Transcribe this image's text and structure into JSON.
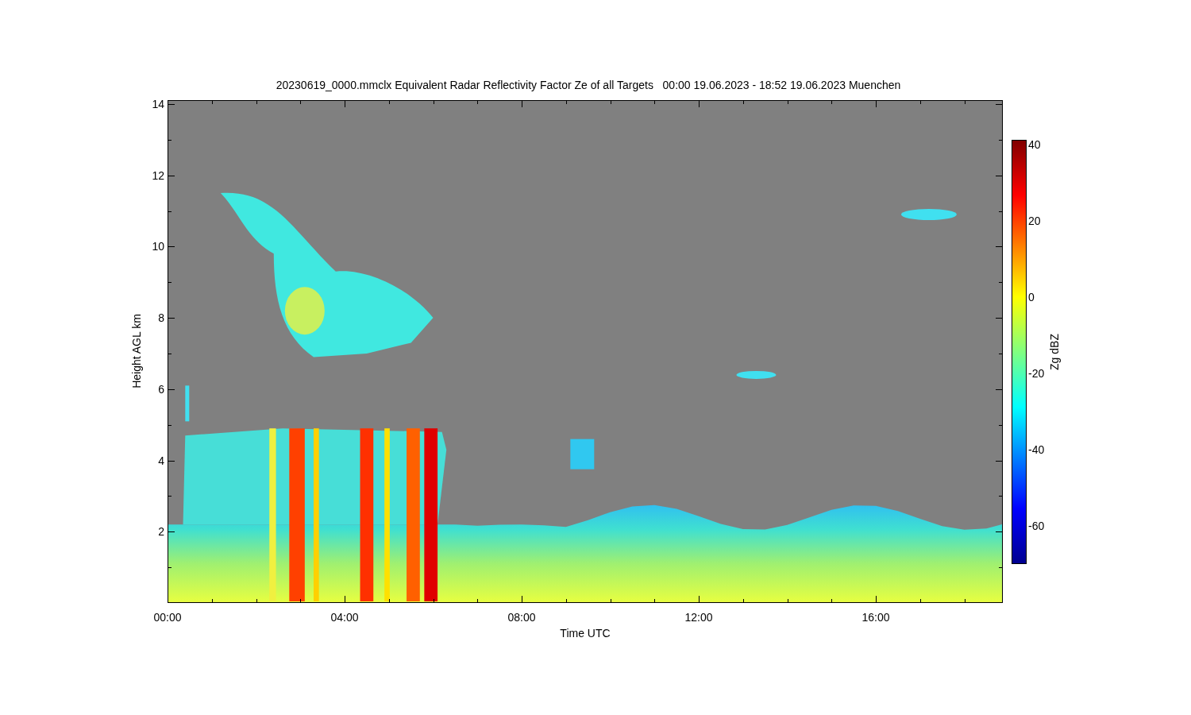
{
  "title": "20230619_0000.mmclx Equivalent Radar Reflectivity Factor Ze of all Targets   00:00 19.06.2023 - 18:52 19.06.2023 Muenchen",
  "y_axis": {
    "label": "Height AGL km",
    "ticks": [
      "14",
      "12",
      "10",
      "8",
      "6",
      "4",
      "2"
    ]
  },
  "x_axis": {
    "label": "Time UTC",
    "ticks": [
      "00:00",
      "04:00",
      "08:00",
      "12:00",
      "16:00"
    ]
  },
  "colorbar": {
    "label": "Zg dBZ",
    "ticks": [
      "40",
      "20",
      "0",
      "-20",
      "-40",
      "-60"
    ]
  }
}
